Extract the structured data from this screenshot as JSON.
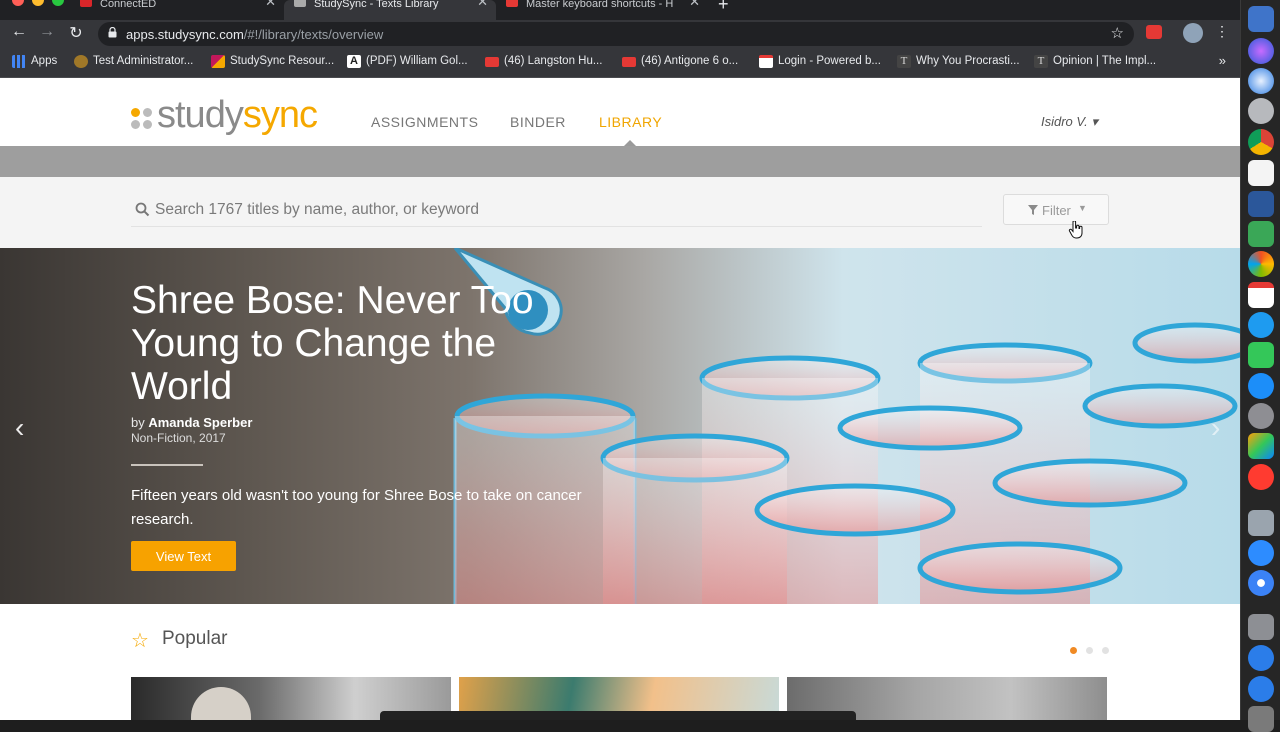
{
  "browser": {
    "tabs": [
      {
        "title": "ConnectED",
        "favicon_color": "#d9262a",
        "active": false
      },
      {
        "title": "StudySync - Texts Library",
        "favicon_color": "#aaaaaa",
        "active": true
      },
      {
        "title": "Master keyboard shortcuts - H",
        "favicon_color": "#e53935",
        "active": false
      }
    ],
    "url_host": "apps.studysync.com",
    "url_path": "/#!/library/texts/overview",
    "bookmarks": [
      {
        "label": "Apps",
        "icon": "apps-grid-icon",
        "color": "#4285f4"
      },
      {
        "label": "Test Administrator...",
        "icon": "shield-icon",
        "color": "#a07828"
      },
      {
        "label": "StudySync Resour...",
        "icon": "studysync-icon",
        "color": "#c2185b"
      },
      {
        "label": "(PDF) William Gol...",
        "icon": "academia-icon",
        "color": "#ffffff"
      },
      {
        "label": "(46) Langston Hu...",
        "icon": "youtube-icon",
        "color": "#e53935"
      },
      {
        "label": "(46) Antigone 6 o...",
        "icon": "youtube-icon",
        "color": "#e53935"
      },
      {
        "label": "Login - Powered b...",
        "icon": "gmail-icon",
        "color": "#ffffff"
      },
      {
        "label": "Why You Procrasti...",
        "icon": "nyt-icon",
        "color": "#444444"
      },
      {
        "label": "Opinion | The Impl...",
        "icon": "nyt-icon",
        "color": "#444444"
      }
    ]
  },
  "site": {
    "logo_study": "study",
    "logo_sync": "sync",
    "nav": [
      "ASSIGNMENTS",
      "BINDER",
      "LIBRARY"
    ],
    "active_nav": "LIBRARY",
    "user": "Isidro V. ▾",
    "brand_color": "#f5a800"
  },
  "search": {
    "placeholder": "Search 1767 titles by name, author, or keyword",
    "filter_label": "Filter"
  },
  "hero": {
    "title": "Shree Bose: Never Too Young to Change the World",
    "by_prefix": "by",
    "author": "Amanda Sperber",
    "genre": "Non-Fiction, 2017",
    "blurb": "Fifteen years old wasn't too young for Shree Bose to take on cancer research.",
    "button": "View Text",
    "prev": "‹",
    "next": "›"
  },
  "popular": {
    "heading": "Popular",
    "pages": 3,
    "current_page": 1
  }
}
